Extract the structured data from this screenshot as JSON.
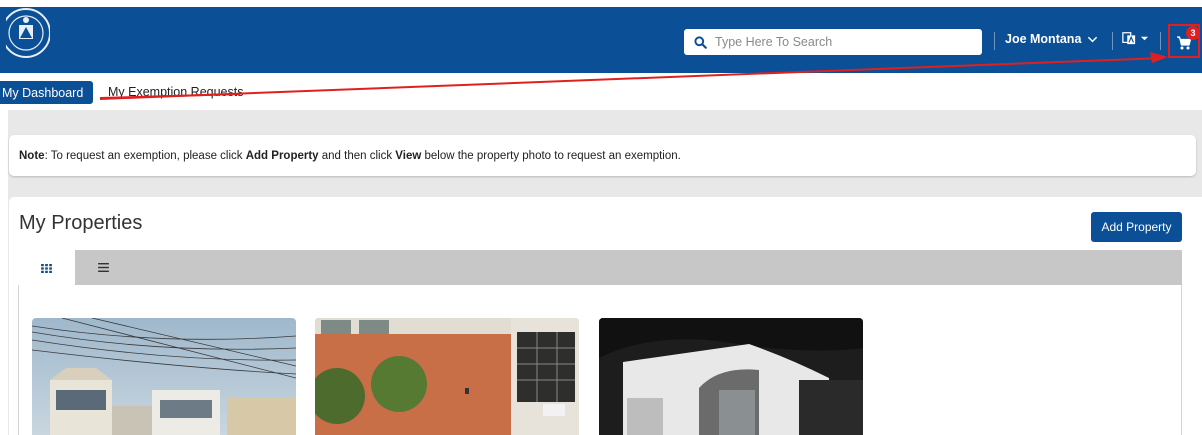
{
  "header": {
    "search_placeholder": "Type Here To Search",
    "user_name": "Joe Montana",
    "cart_count": "3",
    "icons": [
      "seal-logo",
      "search-icon",
      "chevron-down-icon",
      "language-icon",
      "caret-down-icon",
      "cart-icon"
    ]
  },
  "tabs": {
    "active": "My Dashboard",
    "other": "My Exemption Requests"
  },
  "note": {
    "label": "Note",
    "text1": ": To request an exemption, please click ",
    "bold1": "Add Property",
    "text2": " and then click ",
    "bold2": "View",
    "text3": " below the property photo to request an exemption."
  },
  "properties": {
    "title": "My Properties",
    "add_button": "Add Property",
    "view_tabs": [
      "grid-view-icon",
      "list-view-icon"
    ],
    "cards": [
      "property-photo-1",
      "property-photo-2",
      "property-photo-3"
    ]
  },
  "colors": {
    "header_blue": "#0b4f96",
    "annotation_red": "#e02020",
    "page_gray": "#e8e8e8"
  }
}
